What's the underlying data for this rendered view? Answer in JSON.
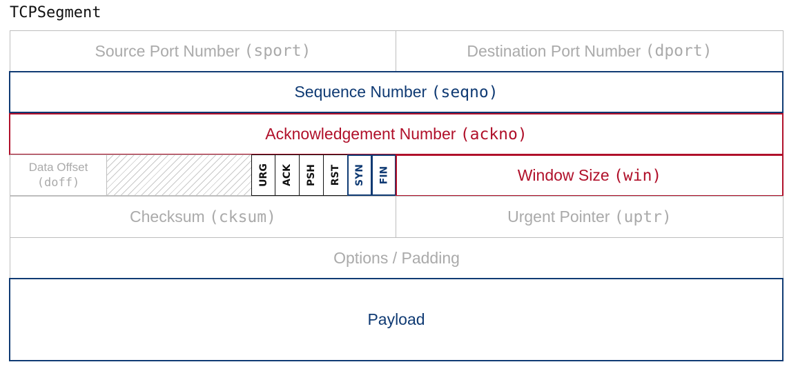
{
  "title": "TCPSegment",
  "colors": {
    "blue": "#0f3a73",
    "red": "#b0102a",
    "gray_text": "#aaaaaa",
    "gray_border": "#bdbdbd"
  },
  "rows": {
    "source_port": {
      "label": "Source Port Number",
      "field": "(sport)"
    },
    "dest_port": {
      "label": "Destination Port Number",
      "field": "(dport)"
    },
    "seqno": {
      "label": "Sequence Number",
      "field": "(seqno)"
    },
    "ackno": {
      "label": "Acknowledgement Number",
      "field": "(ackno)"
    },
    "data_offset": {
      "label": "Data Offset",
      "field": "(doff)"
    },
    "flags": [
      "URG",
      "ACK",
      "PSH",
      "RST",
      "SYN",
      "FIN"
    ],
    "window": {
      "label": "Window Size",
      "field": "(win)"
    },
    "checksum": {
      "label": "Checksum",
      "field": "(cksum)"
    },
    "urgent": {
      "label": "Urgent Pointer",
      "field": "(uptr)"
    },
    "options": {
      "label": "Options / Padding"
    },
    "payload": {
      "label": "Payload"
    }
  }
}
